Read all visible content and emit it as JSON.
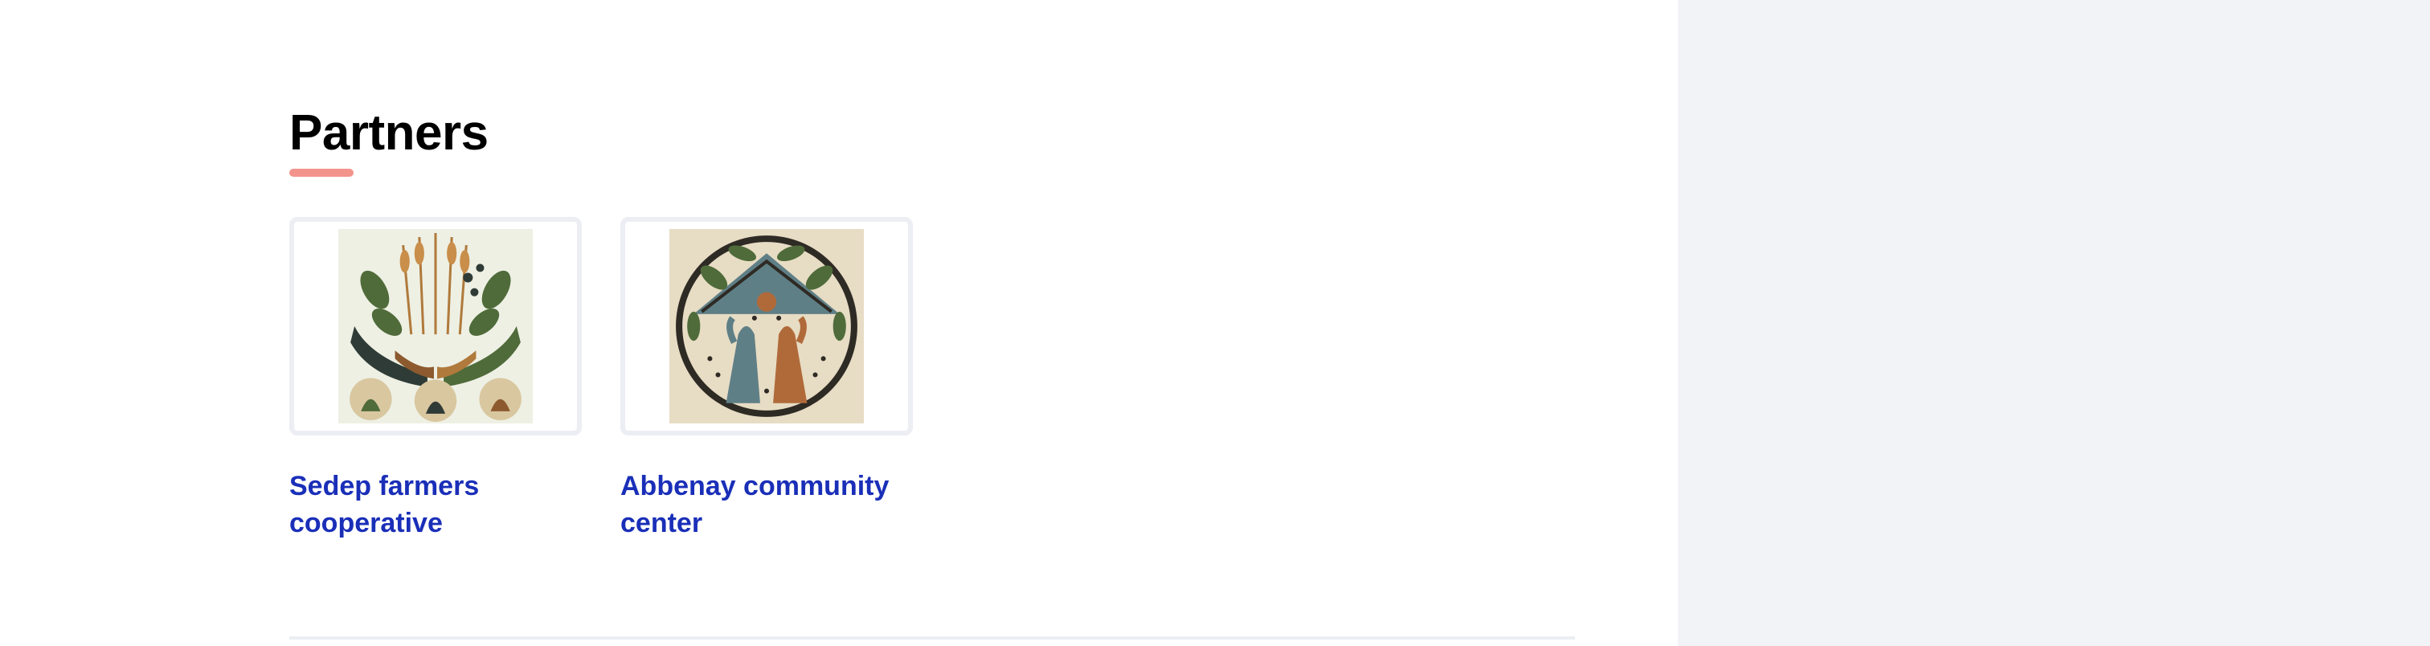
{
  "partners_section": {
    "title": "Partners",
    "accent_color": "#f2938c",
    "link_color": "#1a2fb8",
    "items": [
      {
        "name": "Sedep farmers cooperative",
        "logo_icon": "hands-plants-logo"
      },
      {
        "name": "Abbenay community center",
        "logo_icon": "hands-community-logo"
      }
    ]
  },
  "sidebar": {
    "background": "#f2f3f7"
  }
}
